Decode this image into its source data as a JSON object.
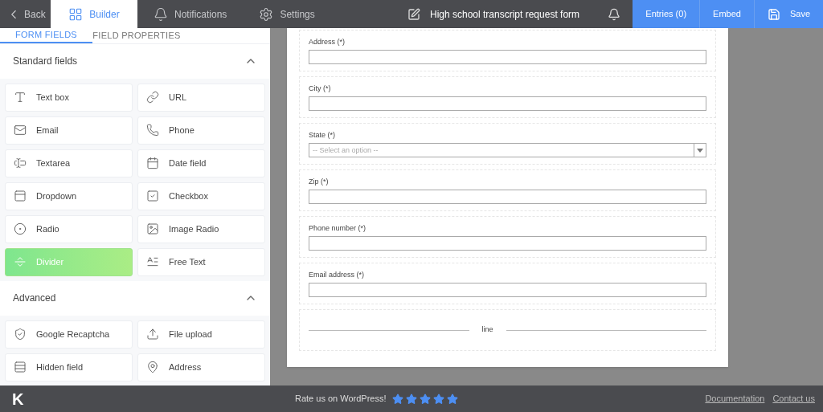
{
  "top_nav": [
    {
      "label": "Back",
      "kind": "back",
      "selected": false
    },
    {
      "label": "Builder",
      "kind": "builder",
      "selected": true
    },
    {
      "label": "Notifications",
      "kind": "bell",
      "selected": false
    },
    {
      "label": "Settings",
      "kind": "gear",
      "selected": false
    }
  ],
  "form_title": "High school transcript request form",
  "actions": [
    {
      "label": "Entries (0)",
      "kind": "text"
    },
    {
      "label": "Embed",
      "kind": "text"
    },
    {
      "label": "Save",
      "kind": "save"
    }
  ],
  "sidebar_tabs": [
    {
      "label": "FORM FIELDS",
      "selected": true
    },
    {
      "label": "FIELD PROPERTIES",
      "selected": false
    }
  ],
  "sections": [
    {
      "title": "Standard fields",
      "expanded": true,
      "items": [
        {
          "label": "Text box",
          "kind": "textbox",
          "selected": false
        },
        {
          "label": "URL",
          "kind": "link",
          "selected": false
        },
        {
          "label": "Email",
          "kind": "mail",
          "selected": false
        },
        {
          "label": "Phone",
          "kind": "phone",
          "selected": false
        },
        {
          "label": "Textarea",
          "kind": "textarea",
          "selected": false
        },
        {
          "label": "Date field",
          "kind": "date",
          "selected": false
        },
        {
          "label": "Dropdown",
          "kind": "dropdown",
          "selected": false
        },
        {
          "label": "Checkbox",
          "kind": "checkbox",
          "selected": false
        },
        {
          "label": "Radio",
          "kind": "radio",
          "selected": false
        },
        {
          "label": "Image Radio",
          "kind": "image",
          "selected": false
        },
        {
          "label": "Divider",
          "kind": "divider",
          "selected": true
        },
        {
          "label": "Free Text",
          "kind": "freetext",
          "selected": false
        }
      ]
    },
    {
      "title": "Advanced",
      "expanded": true,
      "items": [
        {
          "label": "Google Recaptcha",
          "kind": "captcha",
          "selected": false
        },
        {
          "label": "File upload",
          "kind": "upload",
          "selected": false
        },
        {
          "label": "Hidden field",
          "kind": "hidden",
          "selected": false
        },
        {
          "label": "Address",
          "kind": "pin",
          "selected": false
        }
      ]
    }
  ],
  "form_fields": [
    {
      "kind": "text",
      "label": "Address (*)"
    },
    {
      "kind": "text",
      "label": "City (*)"
    },
    {
      "kind": "select",
      "label": "State (*)",
      "placeholder": "-- Select an option --"
    },
    {
      "kind": "text",
      "label": "Zip (*)"
    },
    {
      "kind": "text",
      "label": "Phone number (*)"
    },
    {
      "kind": "text",
      "label": "Email address (*)"
    },
    {
      "kind": "divider",
      "label": "line"
    }
  ],
  "footer": {
    "logo": "K",
    "rate_text": "Rate us on WordPress!",
    "stars": 5,
    "links": [
      "Documentation",
      "Contact us"
    ]
  }
}
